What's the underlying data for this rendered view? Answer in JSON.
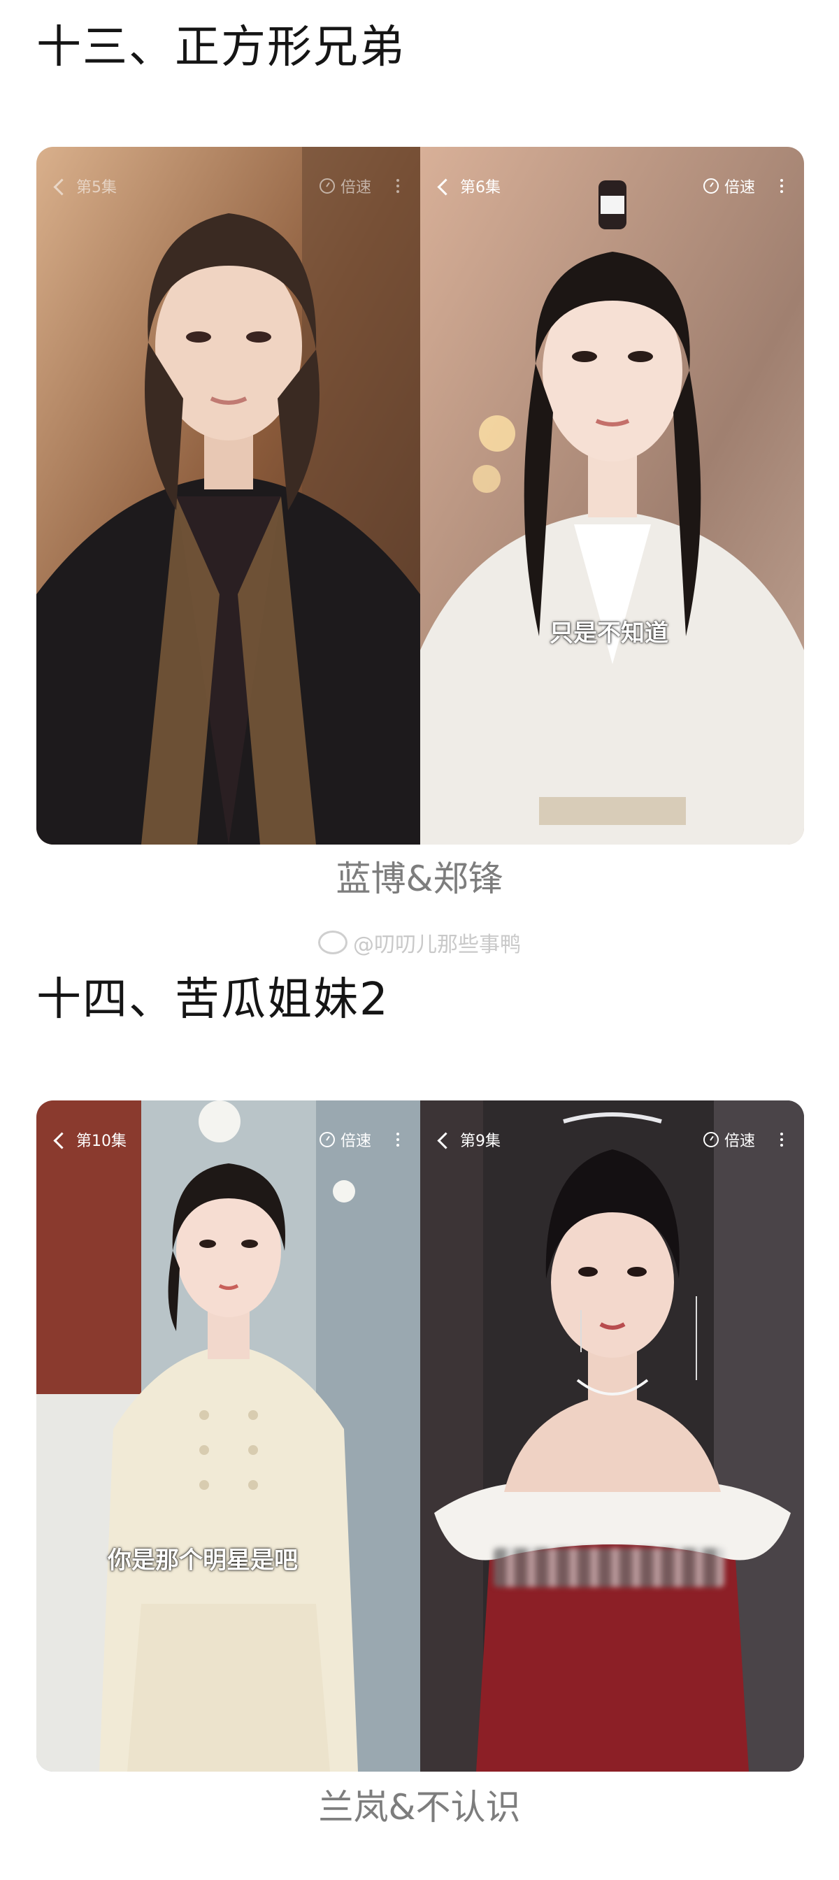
{
  "sections": [
    {
      "title": "十三、正方形兄弟",
      "left_panel": {
        "episode": "第5集",
        "speed": "倍速",
        "subtitle": ""
      },
      "right_panel": {
        "episode": "第6集",
        "speed": "倍速",
        "subtitle": "只是不知道"
      },
      "caption": "蓝博&郑锋"
    },
    {
      "title": "十四、苦瓜姐妹2",
      "left_panel": {
        "episode": "第10集",
        "speed": "倍速",
        "subtitle": "你是那个明星是吧"
      },
      "right_panel": {
        "episode": "第9集",
        "speed": "倍速",
        "subtitle": ""
      },
      "caption": "兰岚&不认识"
    }
  ],
  "watermark": "@叨叨儿那些事鸭",
  "icons": {
    "back": "chevron-left-icon",
    "speed": "speed-icon",
    "more": "more-vertical-icon",
    "watermark": "weibo-icon"
  }
}
